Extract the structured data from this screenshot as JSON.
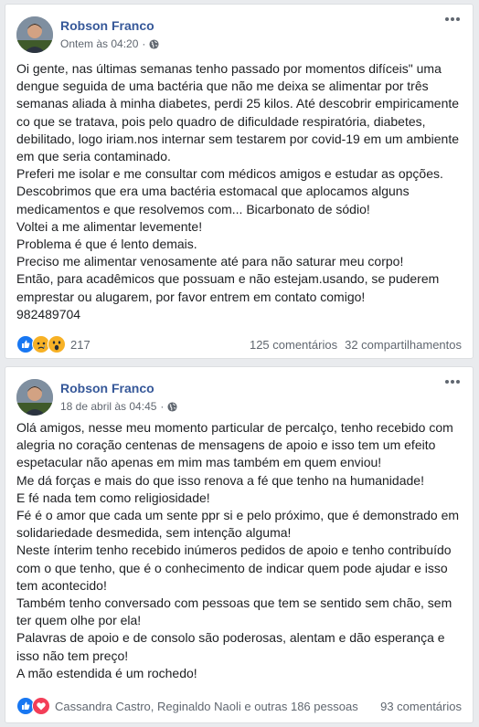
{
  "colors": {
    "background": "#e9ebee",
    "author_link": "#365899",
    "meta_text": "#606770",
    "like_blue": "#1877f2",
    "love_red": "#f33e58",
    "emoji_yellow": "#f7b125"
  },
  "icons": {
    "privacy": "globe-icon",
    "menu": "ellipsis-icon",
    "reactions_post1": [
      "like-icon",
      "sad-icon",
      "wow-icon"
    ],
    "reactions_post2": [
      "like-icon",
      "love-icon"
    ]
  },
  "posts": [
    {
      "author": "Robson Franco",
      "time": "Ontem às 04:20",
      "separator": "·",
      "paragraphs": [
        "Oi gente, nas últimas semanas tenho passado por momentos difíceis\" uma dengue seguida de uma bactéria que não me deixa se alimentar por três semanas aliada à minha diabetes, perdi 25 kilos. Até descobrir empiricamente co que se tratava, pois pelo quadro de dificuldade respiratória, diabetes, debilitado, logo iriam.nos internar sem testarem por covid-19 em um ambiente em que seria contaminado.",
        "Preferi me isolar e me consultar com médicos amigos e estudar as opções.",
        "Descobrimos que era uma bactéria estomacal que aplocamos alguns medicamentos e que resolvemos com... Bicarbonato de sódio!",
        "Voltei a me alimentar levemente!",
        "Problema é que é lento demais.",
        "Preciso me alimentar venosamente até para não saturar meu corpo!",
        "Então, para acadêmicos que possuam e não estejam.usando, se puderem emprestar ou alugarem, por favor entrem em contato comigo!",
        "982489704"
      ],
      "reaction_count": "217",
      "comments": "125 comentários",
      "shares": "32 compartilhamentos"
    },
    {
      "author": "Robson Franco",
      "time": "18 de abril às 04:45",
      "separator": "·",
      "paragraphs": [
        "Olá amigos, nesse meu momento particular de percalço, tenho recebido com alegria no coração centenas de mensagens de apoio e isso tem um efeito espetacular não apenas em mim mas também em quem enviou!",
        "Me dá forças e mais do que isso renova a fé que tenho na humanidade!",
        "E fé nada tem como religiosidade!",
        "Fé é o amor que cada um sente ppr si e pelo próximo, que é demonstrado em solidariedade desmedida, sem intenção alguma!",
        "Neste ínterim tenho recebido inúmeros pedidos de apoio e tenho contribuído com o que tenho, que é o conhecimento de indicar quem pode ajudar e isso tem acontecido!",
        "Também tenho conversado com pessoas que tem se sentido sem chão, sem ter quem olhe por ela!",
        "Palavras de apoio e de consolo são poderosas, alentam e dão esperança e isso não tem preço!",
        "A mão estendida é um rochedo!"
      ],
      "reaction_count": "Cassandra Castro, Reginaldo Naoli e outras 186 pessoas",
      "comments": "93 comentários"
    }
  ]
}
